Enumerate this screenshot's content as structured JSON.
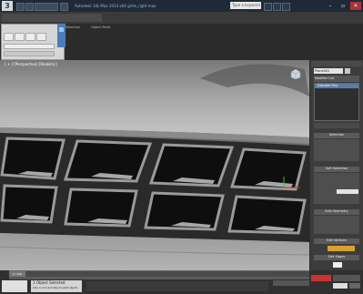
{
  "title_bar": {
    "logo_text": "3",
    "title": "Autodesk 3ds Max 2014 x64   grille_right.max",
    "search_placeholder": "Type a keyword or phrase"
  },
  "window_controls": {
    "minimize": "–",
    "maximize": "▫",
    "close": "✕"
  },
  "menu_tabs": [
    "Graphite Modeling Tools",
    "Freeform",
    "Selection",
    "Object Paint"
  ],
  "ribbon_tabs": [
    "Graphite Modeling Tools",
    "Freeform"
  ],
  "viewport": {
    "label": "[ + ] [Perspective] [Realistic]"
  },
  "command_panel": {
    "object_field": "Plane001",
    "modifier_list": "Modifier List",
    "stack_item": "Editable Poly",
    "rollouts": [
      "Selection",
      "Soft Selection",
      "Edit Geometry",
      "Edit Vertices",
      "Edit Edges"
    ],
    "color": "#c8c8c8"
  },
  "status": {
    "prompt": "1 Object Selected",
    "hint": "Click or click-and-drag to select objects"
  },
  "time": {
    "frame_readout": "0 / 100"
  },
  "colors": {
    "title_bar": "#1e2a38",
    "accent": "#4b7db8",
    "viewport_bg": "#6d6d6d",
    "panel_bg": "#3c3c3c"
  }
}
